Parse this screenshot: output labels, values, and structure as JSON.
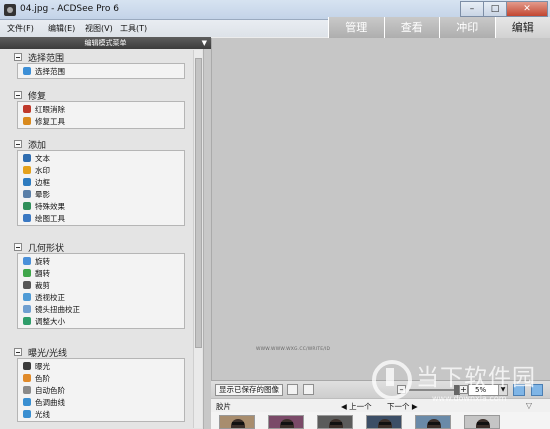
{
  "window": {
    "title": "04.jpg - ACDSee Pro 6",
    "minimize": "–",
    "maximize": "□",
    "close": "✕"
  },
  "menu": [
    "文件(F)",
    "编辑(E)",
    "视图(V)",
    "工具(T)"
  ],
  "mode_tabs": [
    {
      "label": "管理",
      "active": false
    },
    {
      "label": "查看",
      "active": false
    },
    {
      "label": "冲印",
      "active": false
    },
    {
      "label": "编辑",
      "active": true
    }
  ],
  "panel": {
    "header": "编辑模式菜单",
    "header_arrow": "▼",
    "groups": [
      {
        "title": "选择范围",
        "tools": [
          {
            "label": "选择范围",
            "icon": "selection-icon",
            "color": "#3d8fd6"
          }
        ]
      },
      {
        "title": "修复",
        "tools": [
          {
            "label": "红眼消除",
            "icon": "red-eye-icon",
            "color": "#c0392b"
          },
          {
            "label": "修复工具",
            "icon": "repair-brush-icon",
            "color": "#d98a1e"
          }
        ]
      },
      {
        "title": "添加",
        "tools": [
          {
            "label": "文本",
            "icon": "text-icon",
            "color": "#2f6db0"
          },
          {
            "label": "水印",
            "icon": "watermark-icon",
            "color": "#e4a11b"
          },
          {
            "label": "边框",
            "icon": "border-icon",
            "color": "#2e7bbf"
          },
          {
            "label": "晕影",
            "icon": "vignette-icon",
            "color": "#5a7fa8"
          },
          {
            "label": "特殊效果",
            "icon": "special-effects-icon",
            "color": "#2f8f5a"
          },
          {
            "label": "绘图工具",
            "icon": "drawing-tools-icon",
            "color": "#3a78c2"
          }
        ]
      },
      {
        "title": "几何形状",
        "tools": [
          {
            "label": "旋转",
            "icon": "rotate-icon",
            "color": "#4a90d9"
          },
          {
            "label": "翻转",
            "icon": "flip-icon",
            "color": "#3fa64a"
          },
          {
            "label": "裁剪",
            "icon": "crop-icon",
            "color": "#555555"
          },
          {
            "label": "透视校正",
            "icon": "perspective-icon",
            "color": "#4f9bd6"
          },
          {
            "label": "镜头扭曲校正",
            "icon": "lens-distortion-icon",
            "color": "#6f9fd0"
          },
          {
            "label": "调整大小",
            "icon": "resize-icon",
            "color": "#2f9d6a"
          }
        ]
      },
      {
        "title": "曝光/光线",
        "tools": [
          {
            "label": "曝光",
            "icon": "exposure-icon",
            "color": "#3a3a3a"
          },
          {
            "label": "色阶",
            "icon": "levels-icon",
            "color": "#e08a2a"
          },
          {
            "label": "自动色阶",
            "icon": "auto-levels-icon",
            "color": "#8a8a8a"
          },
          {
            "label": "色调曲线",
            "icon": "tone-curve-icon",
            "color": "#3a8fd1"
          },
          {
            "label": "光线",
            "icon": "lighting-icon",
            "color": "#3a8fd1"
          }
        ]
      }
    ]
  },
  "main": {
    "image_url_text": "WWW.WWW.WXG.CC/WRITE/ID"
  },
  "bottom_bar": {
    "show_saved_label": "显示已保存的图像",
    "zoom_minus": "–",
    "zoom_plus": "+",
    "zoom_value": "5%",
    "zoom_dropdown": "▼"
  },
  "filmstrip": {
    "label": "胶片",
    "prev": "◀ 上一个",
    "next": "下一个 ▶",
    "dropdown": "▽",
    "thumb_count": 6
  },
  "watermark": {
    "text": "当下软件园",
    "url": "www.downxia.com"
  }
}
